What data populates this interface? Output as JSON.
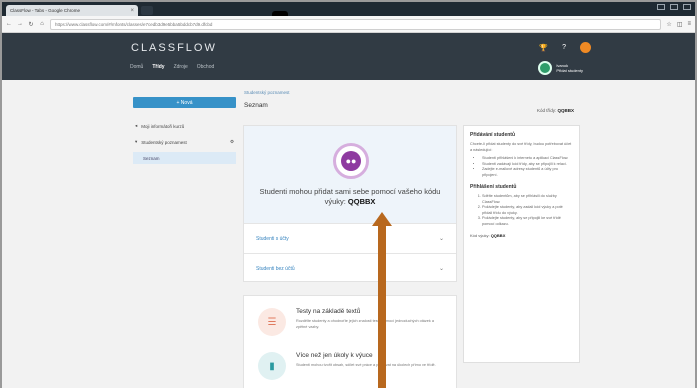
{
  "browser": {
    "tab_title": "ClassFlow - Tabs - Google Chrome",
    "url": "https://www.classflow.com/#/mfonts/classes/e7cedb3d9e5bba5bddcb7d9.dfcbd"
  },
  "app": {
    "brand": "CLASSFLOW",
    "nav": [
      "Domů",
      "Třídy",
      "Zdroje",
      "Obchod"
    ],
    "class_name": "Ivanok",
    "class_sub": "Přidat studenty"
  },
  "sidebar": {
    "new_button": "+ Nová",
    "items": [
      {
        "label": "Moji informátoři kurzů"
      },
      {
        "label": "Studentský poznamest"
      }
    ],
    "selected": "Seznam"
  },
  "main": {
    "breadcrumb": "Studentský poznamest",
    "title": "Seznam",
    "class_code_label": "Kód třídy: ",
    "class_code": "QQBBX",
    "card": {
      "message_prefix": "Studenti mohou přidat sami sebe pomocí vašeho kódu výuky: ",
      "code": "QQBBX"
    },
    "accordions": [
      {
        "label": "Studenti s účty"
      },
      {
        "label": "Studenti bez účtů"
      }
    ],
    "features": [
      {
        "title": "Testy na základě textů",
        "desc": "Rozdělte studenty a ohodnoťte jejich znalosti testy pomocí jednoduchých otázek a zpětné vazby."
      },
      {
        "title": "Více než jen úkoly k výuce",
        "desc": "Studenti mohou tvořit obsah, sdílet své práce a pracovat na úkolech přímo ve třídě."
      }
    ]
  },
  "info": {
    "heading1": "Přidávání studentů",
    "intro": "Chcete-li přidat studenty do své třídy, budou potřebovat účet a následující:",
    "bullets": [
      "Studenti přihlášeni k internetu a aplikaci ClassFlow.",
      "Studenti zadávají kód třídy, aby se připojili k relaci.",
      "Zadejte e-mailové adresy studentů a účty pro připojení."
    ],
    "heading2": "Přihlášení studentů",
    "steps": [
      "Sdělte studentům, aby se přihlásili do služby ClassFlow.",
      "Požádejte studenty, aby zadali kód výuky a poté přidali třídu do výuky.",
      "Požádejte studenty, aby se připojili ke své třídě pomocí odkazu."
    ],
    "code_label": "Kód výuky: ",
    "code": "QQBBX"
  },
  "colors": {
    "header_bg": "#313b44",
    "accent_blue": "#3792c8",
    "purple": "#8e3aa0",
    "arrow": "#b8681e"
  }
}
